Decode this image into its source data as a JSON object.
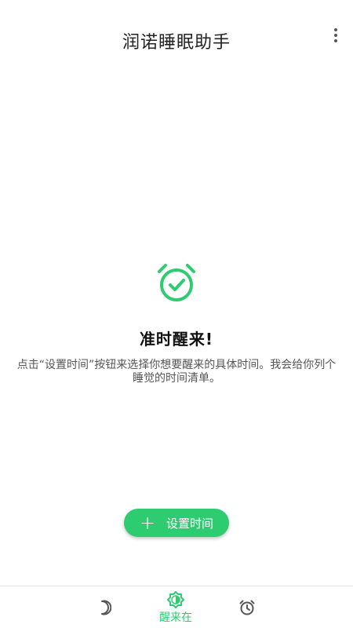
{
  "app_bar": {
    "title": "润诺睡眠助手",
    "more_icon": "more-vert-icon"
  },
  "empty_state": {
    "icon": "alarm-check-icon",
    "title": "准时醒来!",
    "description": "点击“设置时间”按钮来选择你想要醒来的具体时间。我会给你列个睡觉的时间清单。"
  },
  "action": {
    "icon": "plus-icon",
    "plus_glyph": "+",
    "label": "设置时间"
  },
  "bottom_nav": {
    "items": [
      {
        "icon": "moon-icon",
        "label": "",
        "active": false
      },
      {
        "icon": "sun-icon",
        "label": "醒来在",
        "active": true
      },
      {
        "icon": "alarm-clock-icon",
        "label": "",
        "active": false
      }
    ]
  },
  "colors": {
    "accent": "#2ecc71",
    "text": "#222222",
    "muted": "#555555"
  }
}
